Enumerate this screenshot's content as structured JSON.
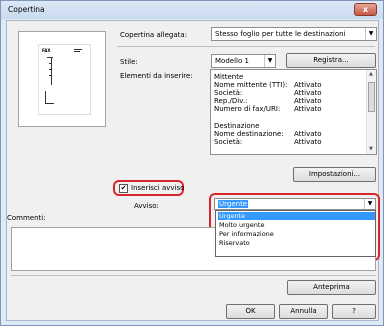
{
  "window": {
    "title": "Copertina",
    "close_glyph": "x"
  },
  "cover": {
    "label": "Copertina allegata:",
    "value": "Stesso foglio per tutte le destinazioni"
  },
  "style": {
    "label": "Stile:",
    "value": "Modello 1",
    "register_button": "Registra..."
  },
  "elements": {
    "label": "Elementi da inserire:",
    "rows": [
      {
        "name": "Mittente",
        "value": ""
      },
      {
        "name": "Nome mittente (TTI):",
        "value": "Attivato"
      },
      {
        "name": "Società:",
        "value": "Attivato"
      },
      {
        "name": "Rep./Div.:",
        "value": "Attivato"
      },
      {
        "name": "Numero di fax/URI:",
        "value": "Attivato"
      },
      {
        "name": "",
        "value": ""
      },
      {
        "name": "Destinazione",
        "value": ""
      },
      {
        "name": "Nome destinazione:",
        "value": "Attivato"
      },
      {
        "name": "Società:",
        "value": "Attivato"
      }
    ],
    "settings_button": "Impostazioni..."
  },
  "preview": {
    "fax_text": "FAX"
  },
  "insert_notice": {
    "label": "Inserisci avviso",
    "checked": true,
    "check_glyph": "✔"
  },
  "notice": {
    "label": "Avviso:",
    "value": "Urgente",
    "options": [
      "Urgente",
      "Molto urgente",
      "Per informazione",
      "Riservato"
    ],
    "selected_index": 0
  },
  "comments": {
    "label": "Commenti:"
  },
  "buttons": {
    "preview": "Anteprima",
    "ok": "OK",
    "cancel": "Annulla",
    "help": "?"
  },
  "colors": {
    "highlight": "#3399ff",
    "annotation_red": "#d9262a"
  }
}
